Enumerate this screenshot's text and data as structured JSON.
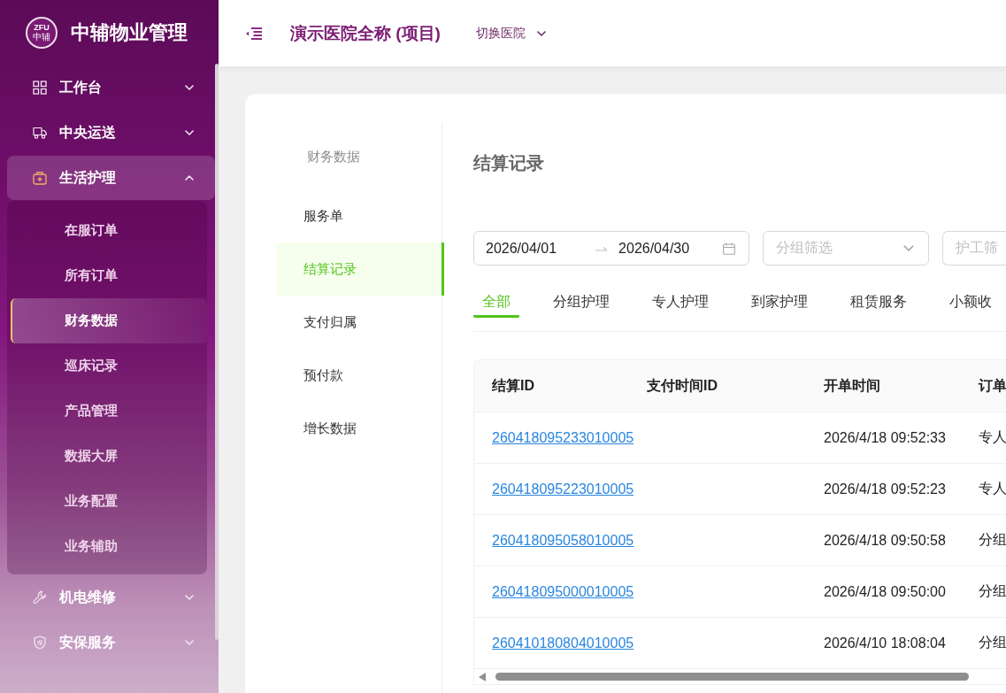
{
  "sidebar": {
    "logo": {
      "letters": "ZFU",
      "subtext": "中辅"
    },
    "brand": "中辅物业管理",
    "menu": [
      {
        "label": "工作台",
        "expanded": false
      },
      {
        "label": "中央运送",
        "expanded": false
      },
      {
        "label": "生活护理",
        "expanded": true,
        "children": [
          {
            "label": "在服订单",
            "selected": false
          },
          {
            "label": "所有订单",
            "selected": false
          },
          {
            "label": "财务数据",
            "selected": true
          },
          {
            "label": "巡床记录",
            "selected": false
          },
          {
            "label": "产品管理",
            "selected": false
          },
          {
            "label": "数据大屏",
            "selected": false
          },
          {
            "label": "业务配置",
            "selected": false
          },
          {
            "label": "业务辅助",
            "selected": false
          }
        ]
      },
      {
        "label": "机电维修",
        "expanded": false
      },
      {
        "label": "安保服务",
        "expanded": false
      }
    ]
  },
  "header": {
    "title": "演示医院全称 (项目)",
    "hospital_switch": {
      "label": "切换医院",
      "expanded": false
    }
  },
  "finance_nav": {
    "heading": "财务数据",
    "items": [
      {
        "label": "服务单",
        "selected": false
      },
      {
        "label": "结算记录",
        "selected": true
      },
      {
        "label": "支付归属",
        "selected": false
      },
      {
        "label": "预付款",
        "selected": false
      },
      {
        "label": "增长数据",
        "selected": false
      }
    ]
  },
  "content": {
    "title": "结算记录",
    "filters": {
      "date_start": "2026/04/01",
      "date_end": "2026/04/30",
      "group_placeholder": "分组筛选",
      "caregiver_placeholder": "护工筛"
    },
    "tabs": [
      {
        "label": "全部",
        "selected": true
      },
      {
        "label": "分组护理",
        "selected": false
      },
      {
        "label": "专人护理",
        "selected": false
      },
      {
        "label": "到家护理",
        "selected": false
      },
      {
        "label": "租赁服务",
        "selected": false
      },
      {
        "label": "小额收",
        "selected": false
      }
    ],
    "table": {
      "columns": [
        "结算ID",
        "支付时间ID",
        "开单时间",
        "订单"
      ],
      "rows": [
        {
          "settlement_id": "260418095233010005",
          "open_time": "2026/4/18 09:52:33",
          "column_4": "专人"
        },
        {
          "settlement_id": "260418095223010005",
          "open_time": "2026/4/18 09:52:23",
          "column_4": "专人"
        },
        {
          "settlement_id": "260418095058010005",
          "open_time": "2026/4/18 09:50:58",
          "column_4": "分组"
        },
        {
          "settlement_id": "260418095000010005",
          "open_time": "2026/4/18 09:50:00",
          "column_4": "分组"
        },
        {
          "settlement_id": "260410180804010005",
          "open_time": "2026/4/10 18:08:04",
          "column_4": "分组"
        }
      ]
    }
  }
}
